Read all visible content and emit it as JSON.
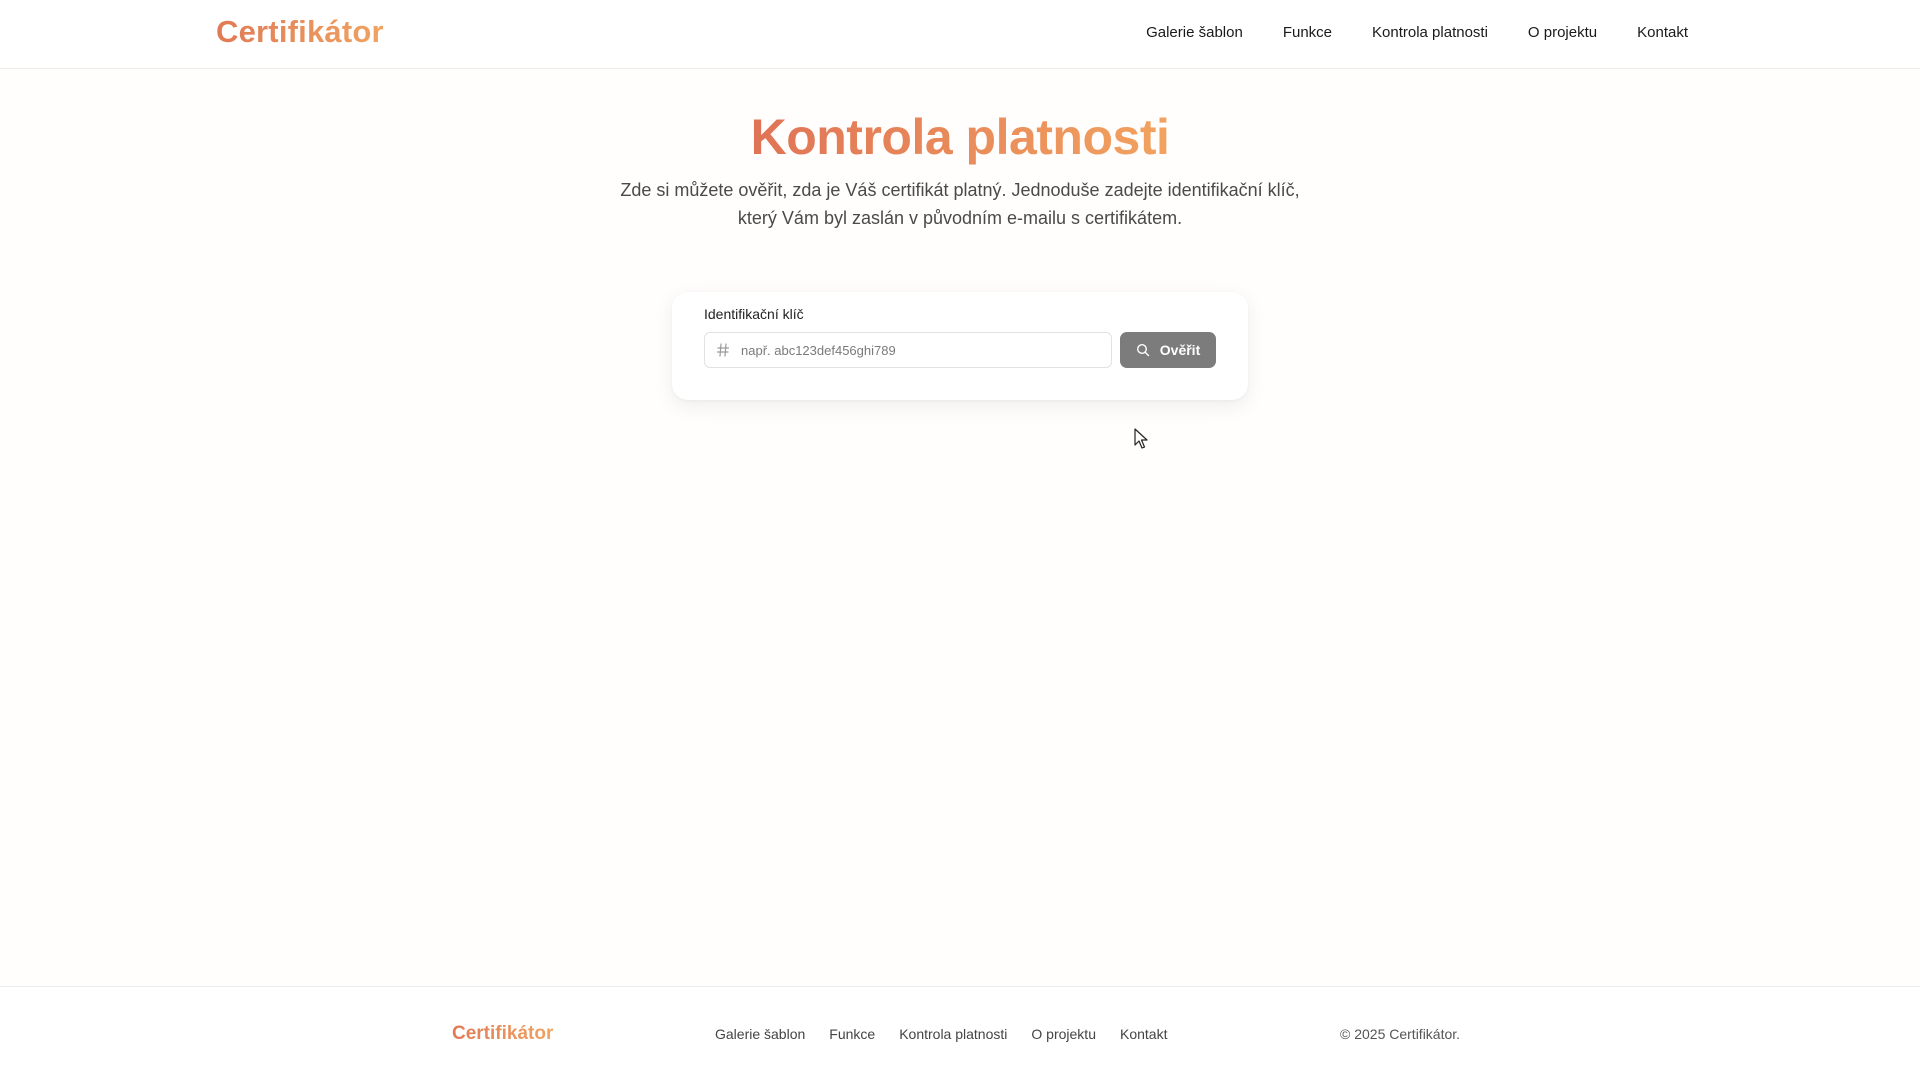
{
  "header": {
    "logo": "Certifikátor",
    "nav": [
      "Galerie šablon",
      "Funkce",
      "Kontrola platnosti",
      "O projektu",
      "Kontakt"
    ]
  },
  "hero": {
    "title": "Kontrola platnosti",
    "description": "Zde si můžete ověřit, zda je Váš certifikát platný. Jednoduše zadejte identifikační klíč, který Vám byl zaslán v původním e-mailu s certifikátem."
  },
  "form": {
    "label": "Identifikační klíč",
    "input_value": "",
    "placeholder": "např. abc123def456ghi789",
    "input_icon": "hash-icon",
    "button_label": "Ověřit",
    "button_icon": "search-icon"
  },
  "footer": {
    "logo": "Certifikátor",
    "nav": [
      "Galerie šablon",
      "Funkce",
      "Kontrola platnosti",
      "O projektu",
      "Kontakt"
    ],
    "copyright": "© 2025 Certifikátor."
  },
  "colors": {
    "brand_gradient_start": "#e07356",
    "brand_gradient_end": "#f2a25f",
    "button_bg": "#7c7c7c"
  }
}
